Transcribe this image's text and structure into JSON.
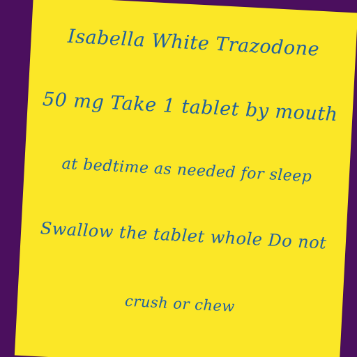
{
  "note": {
    "lines": [
      "Isabella White Trazodone",
      "50 mg Take 1 tablet by mouth",
      "at bedtime as needed for sleep",
      "Swallow the tablet whole Do not",
      "crush or chew"
    ]
  },
  "colors": {
    "background": "#4b0f5e",
    "note": "#fbe727",
    "ink": "#1f5fa0"
  }
}
